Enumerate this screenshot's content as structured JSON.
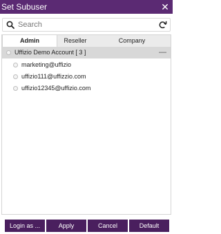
{
  "window": {
    "title": "Set Subuser",
    "close_symbol": "✕"
  },
  "search": {
    "placeholder": "Search",
    "value": ""
  },
  "tabs": [
    {
      "label": "Admin",
      "active": true
    },
    {
      "label": "Reseller",
      "active": false
    },
    {
      "label": "Company",
      "active": false
    }
  ],
  "group": {
    "label": "Uffizio Demo Account [ 3 ]",
    "collapse_symbol": "—"
  },
  "items": [
    {
      "label": "marketing@uffizio"
    },
    {
      "label": "uffizio111@uffizzio.com"
    },
    {
      "label": "uffizio12345@uffizio.com"
    }
  ],
  "buttons": {
    "login_as": "Login as ...",
    "apply": "Apply",
    "cancel": "Cancel",
    "default": "Default"
  },
  "colors": {
    "titlebar": "#5b2a73",
    "button": "#4a1f5e",
    "group_row": "#d8d8d8"
  }
}
